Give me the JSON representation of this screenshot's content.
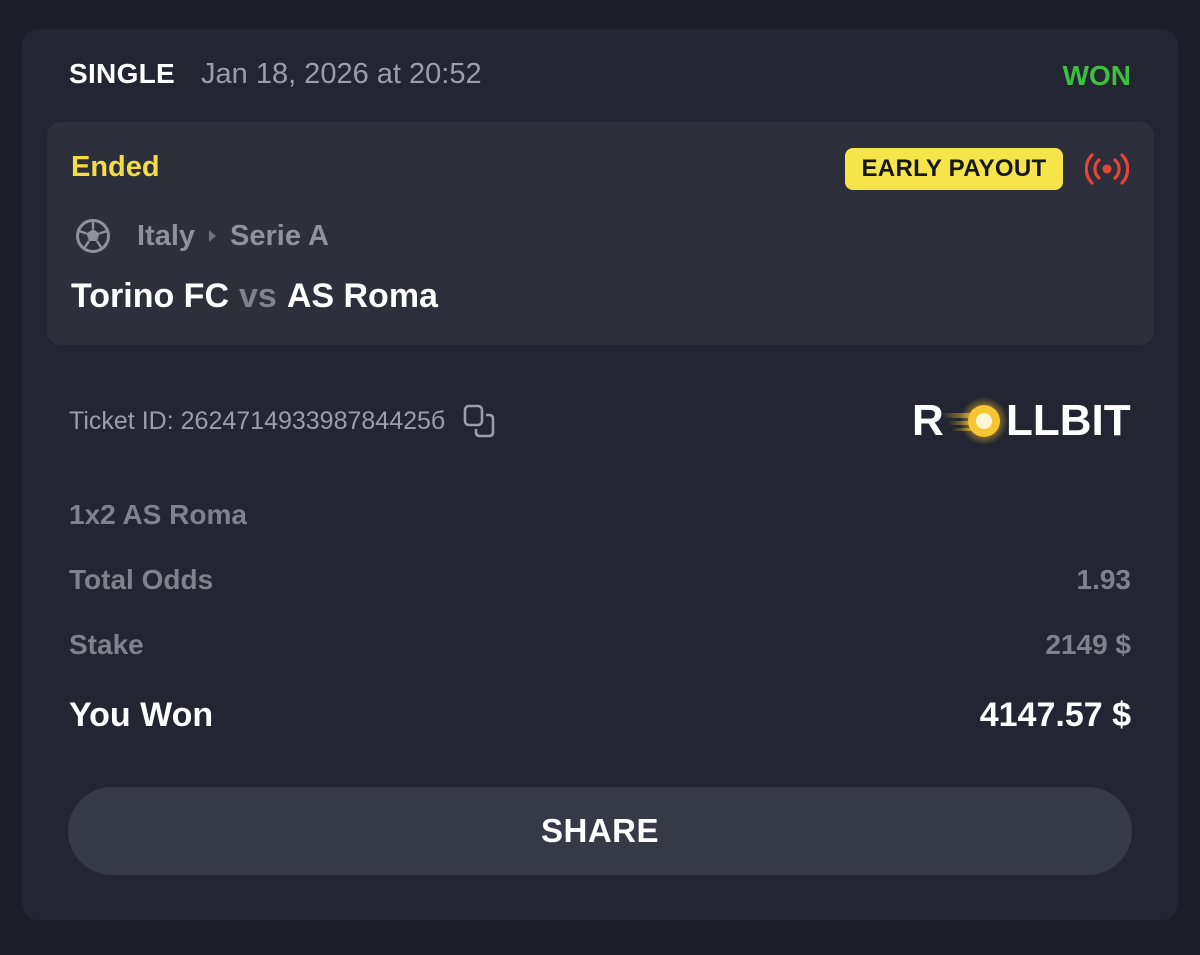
{
  "header": {
    "bet_type": "SINGLE",
    "date": "Jan 18, 2026 at 20:52",
    "status": "WON"
  },
  "event": {
    "status": "Ended",
    "badge": "EARLY PAYOUT",
    "country": "Italy",
    "league": "Serie A",
    "home_team": "Torino FC",
    "vs": "vs",
    "away_team": "AS Roma",
    "sport_icon": "soccer-ball-icon",
    "live_icon": "broadcast-icon"
  },
  "ticket": {
    "label": "Ticket ID:",
    "id": "262471493398784425б",
    "copy_icon": "copy-icon"
  },
  "brand": {
    "name": "ROLLBIT",
    "left": "R",
    "right": "LLBIT"
  },
  "details": {
    "market": "1x2 AS Roma",
    "odds_label": "Total Odds",
    "odds_value": "1.93",
    "stake_label": "Stake",
    "stake_value": "2149 $",
    "won_label": "You Won",
    "won_value": "4147.57 $"
  },
  "actions": {
    "share_label": "SHARE"
  },
  "colors": {
    "background": "#1b1e26",
    "card": "#232632",
    "event_box": "#2d303b",
    "won_green": "#3fbf3f",
    "ended_yellow": "#f3dc45",
    "badge_yellow": "#f6e54a",
    "live_red": "#e5443a",
    "logo_gold": "#f7c531"
  }
}
